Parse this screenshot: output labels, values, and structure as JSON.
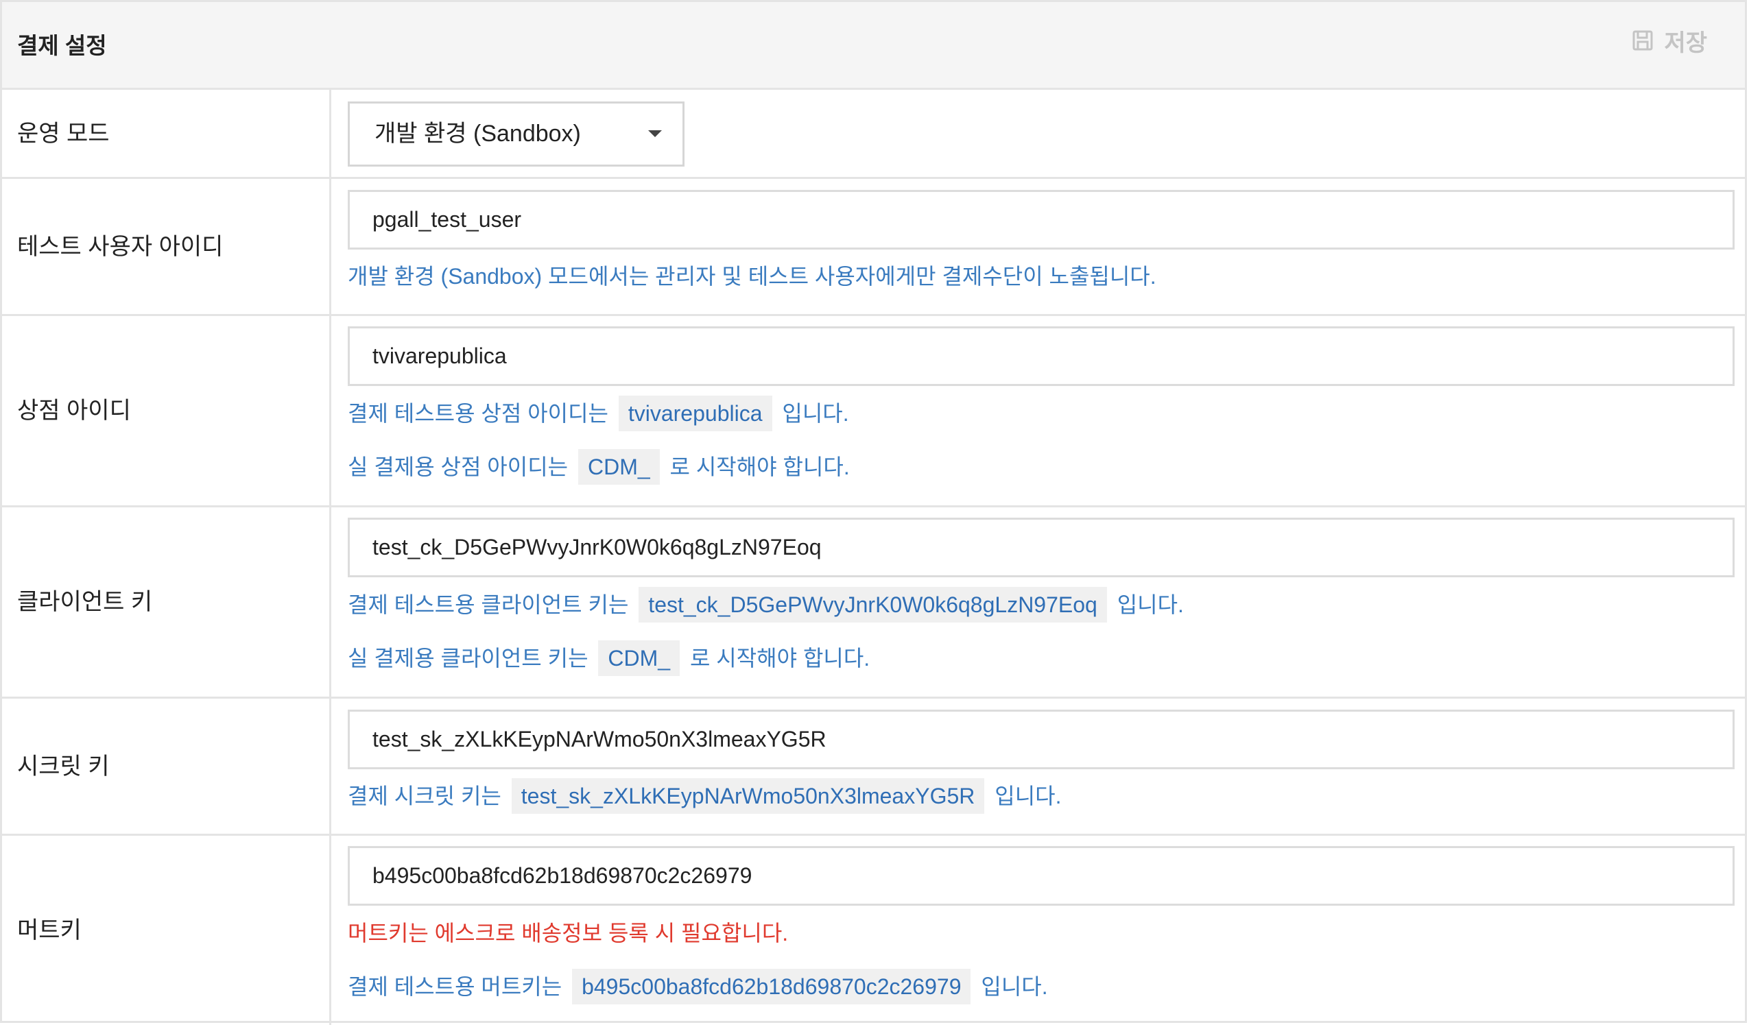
{
  "header": {
    "title": "결제 설정",
    "save_label": "저장"
  },
  "rows": {
    "mode": {
      "label": "운영 모드",
      "selected": "개발 환경 (Sandbox)"
    },
    "test_user": {
      "label": "테스트 사용자 아이디",
      "value": "pgall_test_user",
      "help": "개발 환경 (Sandbox) 모드에서는 관리자 및 테스트 사용자에게만 결제수단이 노출됩니다."
    },
    "store_id": {
      "label": "상점 아이디",
      "value": "tvivarepublica",
      "help1_prefix": "결제 테스트용 상점 아이디는",
      "help1_code": "tvivarepublica",
      "help1_suffix": "입니다.",
      "help2_prefix": "실 결제용 상점 아이디는",
      "help2_code": "CDM_",
      "help2_suffix": "로 시작해야 합니다."
    },
    "client_key": {
      "label": "클라이언트 키",
      "value": "test_ck_D5GePWvyJnrK0W0k6q8gLzN97Eoq",
      "help1_prefix": "결제 테스트용 클라이언트 키는",
      "help1_code": "test_ck_D5GePWvyJnrK0W0k6q8gLzN97Eoq",
      "help1_suffix": "입니다.",
      "help2_prefix": "실 결제용 클라이언트 키는",
      "help2_code": "CDM_",
      "help2_suffix": "로 시작해야 합니다."
    },
    "secret_key": {
      "label": "시크릿 키",
      "value": "test_sk_zXLkKEypNArWmo50nX3lmeaxYG5R",
      "help1_prefix": "결제 시크릿 키는",
      "help1_code": "test_sk_zXLkKEypNArWmo50nX3lmeaxYG5R",
      "help1_suffix": "입니다."
    },
    "mert_key": {
      "label": "머트키",
      "value": "b495c00ba8fcd62b18d69870c2c26979",
      "warning": "머트키는 에스크로 배송정보 등록 시 필요합니다.",
      "help1_prefix": "결제 테스트용 머트키는",
      "help1_code": "b495c00ba8fcd62b18d69870c2c26979",
      "help1_suffix": "입니다."
    }
  },
  "colors": {
    "help_text": "#3a7bbf",
    "warning_text": "#e03a2e",
    "border": "#e4e4e4",
    "header_bg": "#f5f5f5"
  }
}
